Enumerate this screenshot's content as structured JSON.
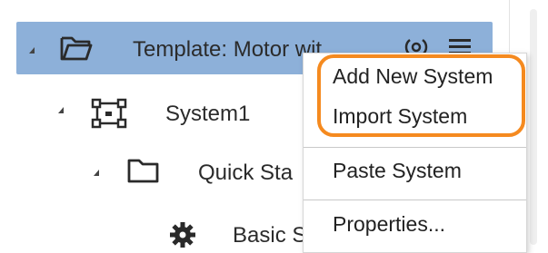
{
  "tree": {
    "items": [
      {
        "label": "Template: Motor wit",
        "icon": "folder-icon"
      },
      {
        "label": "System1",
        "icon": "system-icon"
      },
      {
        "label": "Quick Sta",
        "icon": "folder-icon"
      },
      {
        "label": "Basic Settings",
        "icon": "gear-icon"
      }
    ]
  },
  "context_menu": {
    "items": [
      {
        "label": "Add New System"
      },
      {
        "label": "Import System"
      },
      {
        "label": "Paste System"
      },
      {
        "label": "Properties..."
      }
    ]
  },
  "colors": {
    "selection": "#8db0d9",
    "highlight_outline": "#f58a1f"
  }
}
